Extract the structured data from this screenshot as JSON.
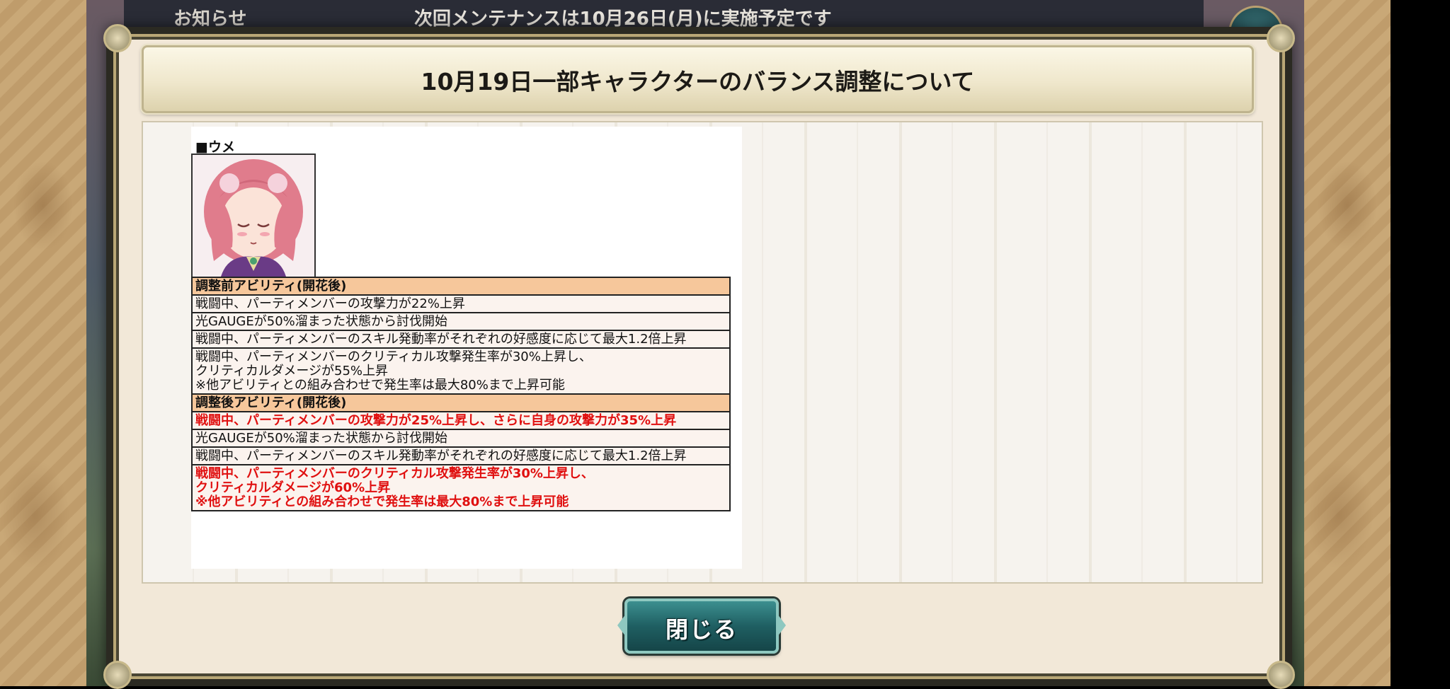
{
  "background": {
    "notice_title": "お知らせ",
    "notice_ticker": "次回メンテナンスは10月26日(月)に実施予定です"
  },
  "dialog": {
    "title": "10月19日一部キャラクターのバランス調整について",
    "character_name": "■ウメ",
    "before_header": "調整前アビリティ(開花後)",
    "before_rows": [
      "戦闘中、パーティメンバーの攻撃力が22%上昇",
      "光GAUGEが50%溜まった状態から討伐開始",
      "戦闘中、パーティメンバーのスキル発動率がそれぞれの好感度に応じて最大1.2倍上昇",
      "戦闘中、パーティメンバーのクリティカル攻撃発生率が30%上昇し、\nクリティカルダメージが55%上昇\n※他アビリティとの組み合わせで発生率は最大80%まで上昇可能"
    ],
    "after_header": "調整後アビリティ(開花後)",
    "after_rows": [
      "戦闘中、パーティメンバーの攻撃力が25%上昇し、さらに自身の攻撃力が35%上昇",
      "光GAUGEが50%溜まった状態から討伐開始",
      "戦闘中、パーティメンバーのスキル発動率がそれぞれの好感度に応じて最大1.2倍上昇",
      "戦闘中、パーティメンバーのクリティカル攻撃発生率が30%上昇し、\nクリティカルダメージが60%上昇\n※他アビリティとの組み合わせで発生率は最大80%まで上昇可能"
    ],
    "close_label": "閉じる"
  },
  "colors": {
    "highlight_red": "#e01010",
    "header_orange": "#f6c79b",
    "button_teal": "#1f5f62"
  }
}
